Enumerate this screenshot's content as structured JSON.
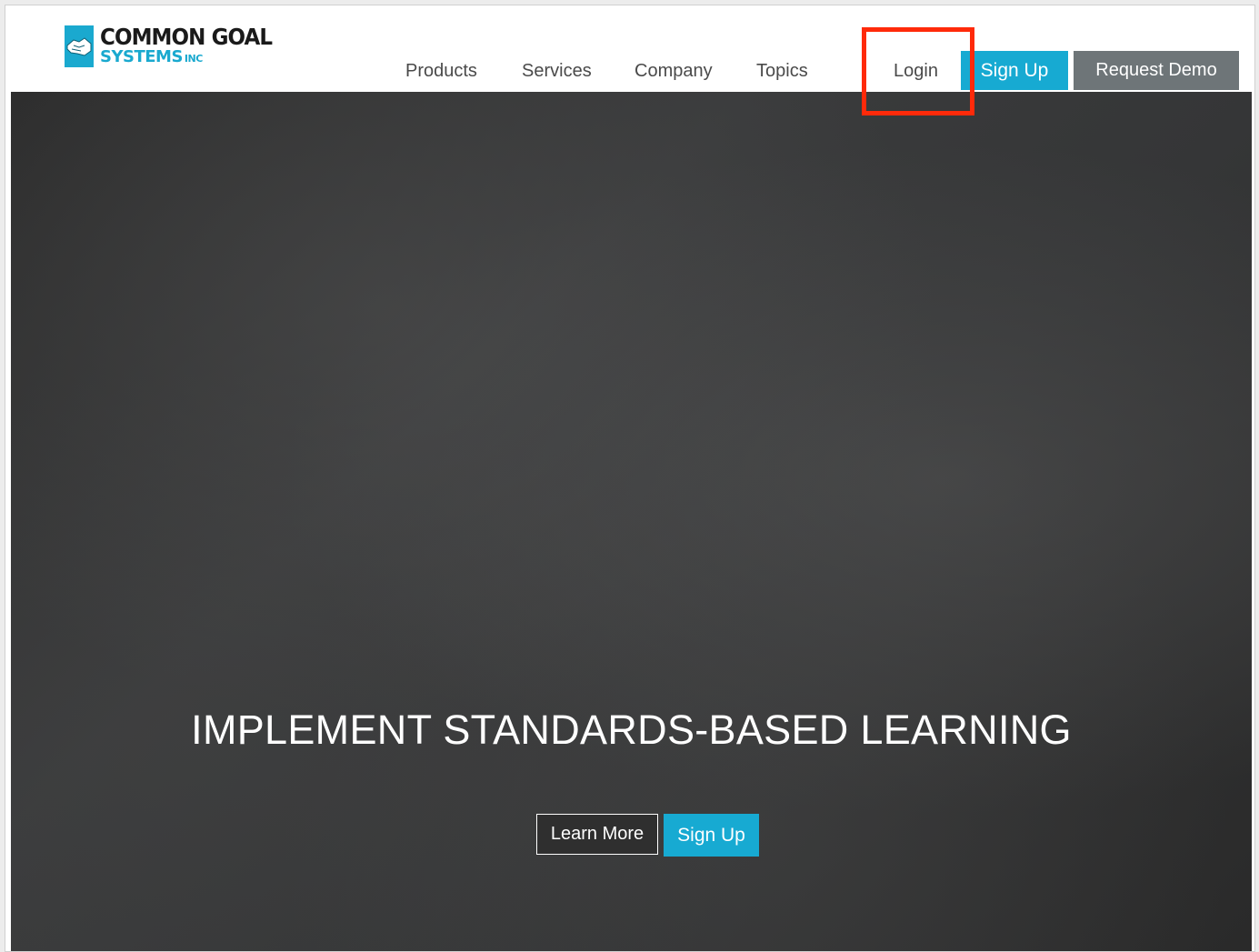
{
  "brand": {
    "name_line1": "COMMON GOAL",
    "name_line2": "SYSTEMS",
    "name_suffix": "INC",
    "accent_color": "#17aad2"
  },
  "nav": {
    "items": [
      {
        "label": "Products"
      },
      {
        "label": "Services"
      },
      {
        "label": "Company"
      },
      {
        "label": "Topics"
      },
      {
        "label": "Login"
      }
    ],
    "signup_label": "Sign Up",
    "demo_label": "Request Demo"
  },
  "hero": {
    "title": "IMPLEMENT STANDARDS-BASED LEARNING",
    "learn_more_label": "Learn More",
    "signup_label": "Sign Up"
  },
  "annotation": {
    "highlight_color": "#ff2a0a",
    "highlight_target": "Login"
  }
}
